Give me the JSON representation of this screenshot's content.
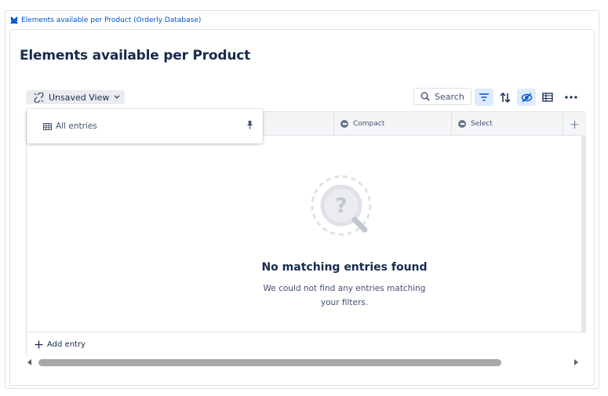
{
  "macro": {
    "header_label": "Elements available per Product (Orderly Database)"
  },
  "page": {
    "title": "Elements available per Product"
  },
  "toolbar": {
    "view_label": "Unsaved View",
    "search_placeholder": "Search",
    "icons": [
      "filter-icon",
      "sort-icon",
      "hide-fields-icon",
      "table-layout-icon",
      "more-icon"
    ]
  },
  "dropdown": {
    "items": [
      {
        "label": "All entries",
        "icon": "table-icon",
        "pinned": true
      }
    ]
  },
  "table": {
    "columns": [
      {
        "label": "Compact",
        "icon": "minus-circle-icon"
      },
      {
        "label": "Select",
        "icon": "minus-circle-icon"
      }
    ],
    "empty_title": "No matching entries found",
    "empty_description": "We could not find any entries matching your filters.",
    "add_entry_label": "Add entry"
  },
  "colors": {
    "link": "#0052cc",
    "active_tool_bg": "#deebff",
    "text": "#172b4d"
  }
}
